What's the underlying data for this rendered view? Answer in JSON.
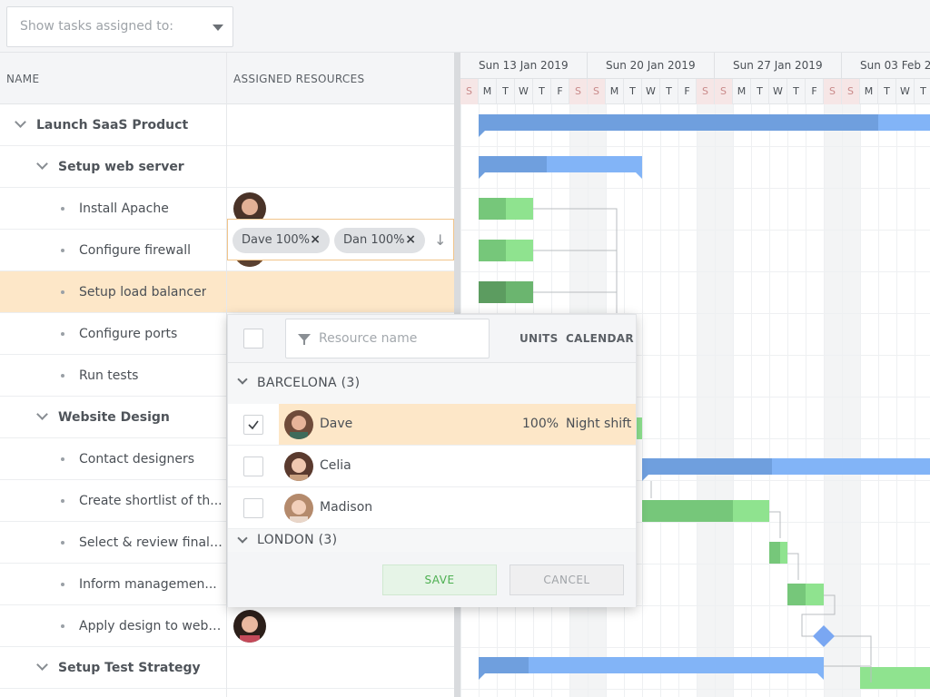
{
  "filter": {
    "placeholder": "Show tasks assigned to:"
  },
  "grid": {
    "col_name": "NAME",
    "col_resources": "ASSIGNED RESOURCES",
    "rows": [
      {
        "label": "Launch SaaS Product",
        "parent": true,
        "level": 0
      },
      {
        "label": "Setup web server",
        "parent": true,
        "level": 1
      },
      {
        "label": "Install Apache",
        "parent": false,
        "level": 2,
        "avatar": "a1"
      },
      {
        "label": "Configure firewall",
        "parent": false,
        "level": 2,
        "avatar": "a2"
      },
      {
        "label": "Setup load balancer",
        "parent": false,
        "level": 2,
        "selected": true
      },
      {
        "label": "Configure ports",
        "parent": false,
        "level": 2
      },
      {
        "label": "Run tests",
        "parent": false,
        "level": 2
      },
      {
        "label": "Website Design",
        "parent": true,
        "level": 1
      },
      {
        "label": "Contact designers",
        "parent": false,
        "level": 2
      },
      {
        "label": "Create shortlist of th...",
        "parent": false,
        "level": 2
      },
      {
        "label": "Select & review final ...",
        "parent": false,
        "level": 2
      },
      {
        "label": "Inform managemen...",
        "parent": false,
        "level": 2
      },
      {
        "label": "Apply design to web ...",
        "parent": false,
        "level": 2,
        "avatar": "a3"
      },
      {
        "label": "Setup Test Strategy",
        "parent": true,
        "level": 1
      }
    ]
  },
  "resource_editor": {
    "chips": [
      {
        "label": "Dave 100%"
      },
      {
        "label": "Dan 100%"
      }
    ]
  },
  "timeline": {
    "weeks": [
      "Sun 13 Jan 2019",
      "Sun 20 Jan 2019",
      "Sun 27 Jan 2019",
      "Sun 03 Feb 2"
    ],
    "days": [
      "S",
      "M",
      "T",
      "W",
      "T",
      "F",
      "S",
      "S",
      "M",
      "T",
      "W",
      "T",
      "F",
      "S",
      "S",
      "M",
      "T",
      "W",
      "T",
      "F",
      "S",
      "S",
      "M",
      "T",
      "W",
      "T"
    ]
  },
  "popup": {
    "search_placeholder": "Resource name",
    "col_units": "UNITS",
    "col_calendar": "CALENDAR",
    "group_barcelona": "BARCELONA (3)",
    "group_london": "LONDON (3)",
    "resources": [
      {
        "name": "Dave",
        "units": "100%",
        "calendar": "Night shift",
        "checked": true
      },
      {
        "name": "Celia",
        "units": "",
        "calendar": "",
        "checked": false
      },
      {
        "name": "Madison",
        "units": "",
        "calendar": "",
        "checked": false
      }
    ],
    "save_label": "SAVE",
    "cancel_label": "CANCEL"
  },
  "colors": {
    "summary_bar": "#6f9fde",
    "summary_bar_light": "#82b4f7",
    "task_bar": "#8fe38f",
    "task_bar_done": "#76c77a",
    "selected_row": "#fde7c8",
    "milestone": "#7aa7f2"
  },
  "icons": {
    "filter": "funnel-icon",
    "check": "check-icon",
    "remove": "close-icon",
    "expand": "chevron-down-icon",
    "sort": "arrow-down-icon"
  }
}
